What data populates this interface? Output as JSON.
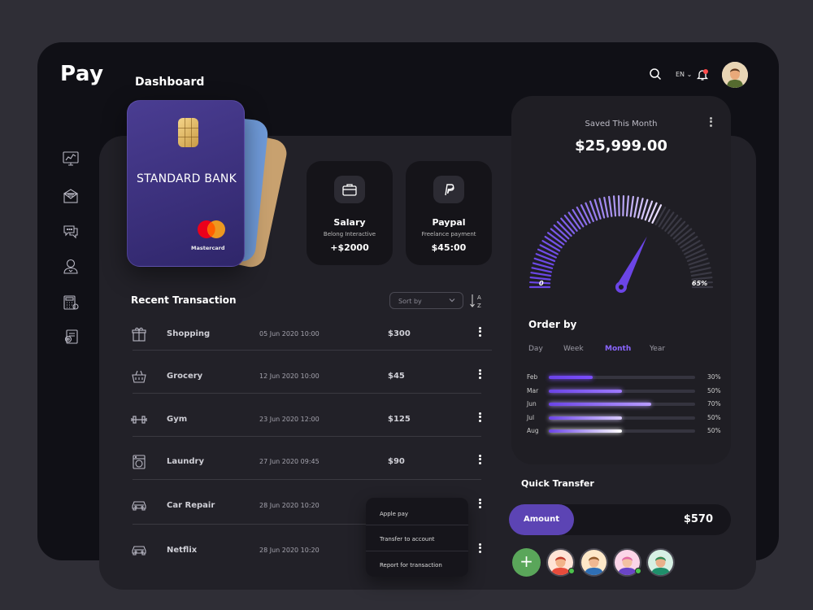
{
  "app": {
    "logo": "Pay",
    "page_title": "Dashboard"
  },
  "header": {
    "language": "EN",
    "notifications_unread": true
  },
  "sidebar": {
    "items": [
      {
        "icon": "analytics-icon"
      },
      {
        "icon": "mail-icon"
      },
      {
        "icon": "chat-icon"
      },
      {
        "icon": "user-icon"
      },
      {
        "icon": "calculator-icon"
      },
      {
        "icon": "settings-document-icon"
      }
    ]
  },
  "card": {
    "bank_name": "STANDARD BANK",
    "network": "Mastercard"
  },
  "income": [
    {
      "title": "Salary",
      "subtitle": "Belong Interactive",
      "amount": "+$2000",
      "icon": "briefcase-icon"
    },
    {
      "title": "Paypal",
      "subtitle": "Freelance payment",
      "amount": "$45:00",
      "icon": "paypal-icon"
    }
  ],
  "transactions": {
    "title": "Recent Transaction",
    "sort_placeholder": "Sort by",
    "rows": [
      {
        "name": "Shopping",
        "date": "05 Jun 2020 10:00",
        "amount": "$300",
        "icon": "gift-icon"
      },
      {
        "name": "Grocery",
        "date": "12 Jun 2020 10:00",
        "amount": "$45",
        "icon": "basket-icon"
      },
      {
        "name": "Gym",
        "date": "23 Jun 2020 12:00",
        "amount": "$125",
        "icon": "dumbbell-icon"
      },
      {
        "name": "Laundry",
        "date": "27 Jun 2020 09:45",
        "amount": "$90",
        "icon": "washing-machine-icon"
      },
      {
        "name": "Car Repair",
        "date": "28 Jun  2020 10:20",
        "amount": "",
        "icon": "car-icon"
      },
      {
        "name": "Netflix",
        "date": "28 Jun  2020 10:20",
        "amount": "",
        "icon": "car-icon"
      }
    ]
  },
  "context_menu": {
    "items": [
      "Apple pay",
      "Transfer to  account",
      "Report for transaction"
    ]
  },
  "savings": {
    "label": "Saved This Month",
    "amount": "$25,999.00",
    "gauge_min": "0",
    "gauge_max": "65%",
    "gauge_value": 0.65
  },
  "order_by": {
    "title": "Order by",
    "tabs": [
      {
        "label": "Day",
        "active": false
      },
      {
        "label": "Week",
        "active": false
      },
      {
        "label": "Month",
        "active": true
      },
      {
        "label": "Year",
        "active": false
      }
    ],
    "rows": [
      {
        "label": "Feb",
        "percent": "30%",
        "value": 0.3,
        "color": "#7b4dff"
      },
      {
        "label": "Mar",
        "percent": "50%",
        "value": 0.5,
        "color": "#9f7bff"
      },
      {
        "label": "Jun",
        "percent": "70%",
        "value": 0.7,
        "color": "#b89cff"
      },
      {
        "label": "Jul",
        "percent": "50%",
        "value": 0.5,
        "color": "#d9cbff"
      },
      {
        "label": "Aug",
        "percent": "50%",
        "value": 0.5,
        "color": "#ffffff"
      }
    ]
  },
  "quick_transfer": {
    "title": "Quick Transfer",
    "amount_label": "Amount",
    "amount_value": "$570",
    "add_label": "+",
    "contacts": [
      {
        "skin": "#f2b38a",
        "hair": "#c0392b",
        "shirt": "#e74c3c",
        "bg": "#ffe3d6",
        "online": true
      },
      {
        "skin": "#f0b892",
        "hair": "#8e5a2a",
        "shirt": "#2f6fb5",
        "bg": "#fde8c8",
        "online": false
      },
      {
        "skin": "#f3c2a3",
        "hair": "#e26aa8",
        "shirt": "#6a45c6",
        "bg": "#fbd5e8",
        "online": true
      },
      {
        "skin": "#e9b08b",
        "hair": "#2e8b57",
        "shirt": "#1f8f6b",
        "bg": "#d7f0e4",
        "online": false
      }
    ]
  }
}
